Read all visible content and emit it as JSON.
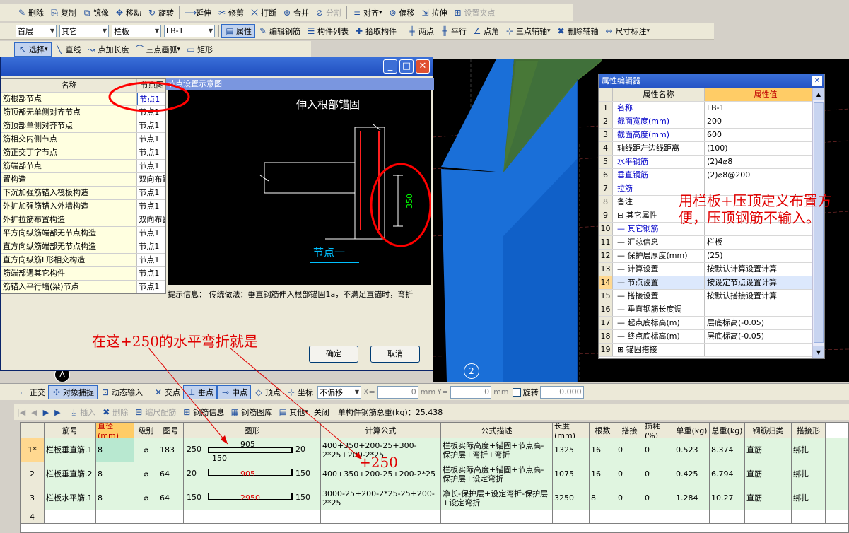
{
  "toolbar1": [
    "删除",
    "复制",
    "镜像",
    "移动",
    "旋转",
    "延伸",
    "修剪",
    "打断",
    "合并",
    "分割",
    "对齐",
    "偏移",
    "拉伸",
    "设置夹点"
  ],
  "toolbar2": {
    "floor": "首层",
    "category": "其它",
    "type": "栏板",
    "element": "LB-1",
    "buttons": [
      "属性",
      "编辑钢筋",
      "构件列表",
      "拾取构件",
      "两点",
      "平行",
      "点角",
      "三点辅轴",
      "删除辅轴",
      "尺寸标注"
    ]
  },
  "toolbar3": [
    "选择",
    "直线",
    "点加长度",
    "三点画弧",
    "矩形"
  ],
  "dialog": {
    "table_header": [
      "名称",
      "节点图"
    ],
    "rows": [
      {
        "name": "筋根部节点",
        "val": "节点1"
      },
      {
        "name": "筋顶部无单侧对齐节点",
        "val": "节点1"
      },
      {
        "name": "筋顶部单侧对齐节点",
        "val": "节点1"
      },
      {
        "name": "筋相交内侧节点",
        "val": "节点1"
      },
      {
        "name": "筋正交丁字节点",
        "val": "节点1"
      },
      {
        "name": "筋端部节点",
        "val": "节点1"
      },
      {
        "name": "置构造",
        "val": "双向布置"
      },
      {
        "name": "下沉加强筋锚入筏板构造",
        "val": "节点1"
      },
      {
        "name": "外扩加强筋锚入外墙构造",
        "val": "节点1"
      },
      {
        "name": "外扩拉筋布置构造",
        "val": "双向布置"
      },
      {
        "name": "平方向纵筋端部无节点构造",
        "val": "节点1"
      },
      {
        "name": "直方向纵筋端部无节点构造",
        "val": "节点1"
      },
      {
        "name": "直方向纵筋L形相交构造",
        "val": "节点1"
      },
      {
        "name": "筋端部遇其它构件",
        "val": "节点1"
      },
      {
        "name": "筋锚入平行墙(梁)节点",
        "val": "节点1"
      }
    ],
    "diagram_title": "节点设置示意图",
    "diagram_heading": "伸入根部锚固",
    "diagram_dim": "350",
    "diagram_caption": "节点一",
    "hint": "提示信息： 传统做法：垂直钢筋伸入根部锚固1a，不满足直锚时，弯折",
    "ok": "确定",
    "cancel": "取消"
  },
  "prop_editor": {
    "title": "属性编辑器",
    "header": [
      "属性名称",
      "属性值"
    ],
    "rows": [
      {
        "n": "1",
        "k": "名称",
        "v": "LB-1",
        "blue": true
      },
      {
        "n": "2",
        "k": "截面宽度(mm)",
        "v": "200",
        "blue": true
      },
      {
        "n": "3",
        "k": "截面高度(mm)",
        "v": "600",
        "blue": true
      },
      {
        "n": "4",
        "k": "轴线距左边线距离",
        "v": "(100)",
        "blue": false
      },
      {
        "n": "5",
        "k": "水平钢筋",
        "v": "(2)4⌀8",
        "blue": true
      },
      {
        "n": "6",
        "k": "垂直钢筋",
        "v": "(2)⌀8@200",
        "blue": true
      },
      {
        "n": "7",
        "k": "拉筋",
        "v": "",
        "blue": true
      },
      {
        "n": "8",
        "k": "备注",
        "v": "",
        "blue": false
      },
      {
        "n": "9",
        "k": "⊟ 其它属性",
        "v": "",
        "blue": false
      },
      {
        "n": "10",
        "k": "— 其它钢筋",
        "v": "",
        "blue": true
      },
      {
        "n": "11",
        "k": "— 汇总信息",
        "v": "栏板",
        "blue": false
      },
      {
        "n": "12",
        "k": "— 保护层厚度(mm)",
        "v": "(25)",
        "blue": false
      },
      {
        "n": "13",
        "k": "— 计算设置",
        "v": "按默认计算设置计算",
        "blue": false
      },
      {
        "n": "14",
        "k": "— 节点设置",
        "v": "按设定节点设置计算",
        "blue": false
      },
      {
        "n": "15",
        "k": "— 搭接设置",
        "v": "按默认搭接设置计算",
        "blue": false
      },
      {
        "n": "16",
        "k": "— 垂直钢筋长度调",
        "v": "",
        "blue": false
      },
      {
        "n": "17",
        "k": "— 起点底标高(m)",
        "v": "层底标高(-0.05)",
        "blue": false
      },
      {
        "n": "18",
        "k": "— 终点底标高(m)",
        "v": "层底标高(-0.05)",
        "blue": false
      },
      {
        "n": "19",
        "k": "⊞ 锚固搭接",
        "v": "",
        "blue": false
      }
    ]
  },
  "annotations": {
    "right": "用栏板+压顶定义布置方便，压顶钢筋不输入。",
    "left": "在这+250的水平弯折就是",
    "plus": "+250"
  },
  "axis_labels": {
    "a": "A",
    "two": "2"
  },
  "snapbar": [
    "正交",
    "对象捕捉",
    "动态输入",
    "交点",
    "垂点",
    "中点",
    "顶点",
    "坐标",
    "不偏移",
    "X=",
    "0",
    "mm",
    "Y=",
    "0",
    "mm",
    "旋转",
    "0.000"
  ],
  "gridbar": {
    "buttons": [
      "插入",
      "删除",
      "缩尺配筋",
      "钢筋信息",
      "钢筋图库",
      "其他",
      "关闭"
    ],
    "total": "单构件钢筋总重(kg)：25.438"
  },
  "grid": {
    "headers": [
      "",
      "筋号",
      "直径(mm)",
      "级别",
      "图号",
      "图形",
      "计算公式",
      "公式描述",
      "长度(mm)",
      "根数",
      "搭接",
      "损耗(%)",
      "单重(kg)",
      "总重(kg)",
      "钢筋归类",
      "搭接形"
    ],
    "rows": [
      {
        "num": "1*",
        "name": "栏板垂直筋.1",
        "dia": "8",
        "grade": "⌀",
        "fig": "183",
        "s_left": "250",
        "s_mid": "905",
        "s_right": "20",
        "s_bottom": "150",
        "formula": "400+350+200-25+300-2*25+200-2*25",
        "desc": "栏板实际高度+锚固+节点高-保护层+弯折+弯折",
        "len": "1325",
        "count": "16",
        "lap": "0",
        "loss": "0",
        "unit": "0.523",
        "total": "8.374",
        "cat": "直筋",
        "lt": "绑扎"
      },
      {
        "num": "2",
        "name": "栏板垂直筋.2",
        "dia": "8",
        "grade": "⌀",
        "fig": "64",
        "s_left": "20",
        "s_mid": "905",
        "s_right": "150",
        "s_bottom": "",
        "formula": "400+350+200-25+200-2*25",
        "desc": "栏板实际高度+锚固+节点高-保护层+设定弯折",
        "len": "1075",
        "count": "16",
        "lap": "0",
        "loss": "0",
        "unit": "0.425",
        "total": "6.794",
        "cat": "直筋",
        "lt": "绑扎"
      },
      {
        "num": "3",
        "name": "栏板水平筋.1",
        "dia": "8",
        "grade": "⌀",
        "fig": "64",
        "s_left": "150",
        "s_mid": "2950",
        "s_right": "150",
        "s_bottom": "",
        "formula": "3000-25+200-2*25-25+200-2*25",
        "desc": "净长-保护层+设定弯折-保护层+设定弯折",
        "len": "3250",
        "count": "8",
        "lap": "0",
        "loss": "0",
        "unit": "1.284",
        "total": "10.27",
        "cat": "直筋",
        "lt": "绑扎"
      },
      {
        "num": "4"
      }
    ]
  },
  "colors": {
    "accent_red": "#ff0000",
    "diagram_cyan": "#00c0ff",
    "diagram_green": "#00ff00",
    "beam_blue": "#1a6fd8",
    "beam_green": "#3a6a30"
  }
}
